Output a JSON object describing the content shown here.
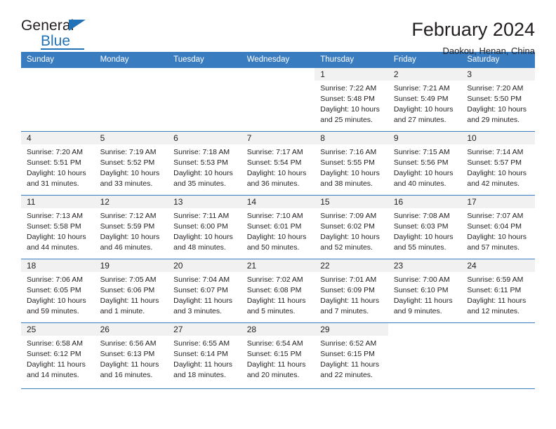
{
  "brand": {
    "name_part1": "General",
    "name_part2": "Blue"
  },
  "header": {
    "title": "February 2024",
    "subtitle": "Daokou, Henan, China"
  },
  "calendar": {
    "day_headers": [
      "Sunday",
      "Monday",
      "Tuesday",
      "Wednesday",
      "Thursday",
      "Friday",
      "Saturday"
    ],
    "colors": {
      "header_blue": "#3a7cc0",
      "daynum_band": "#f1f1f1",
      "text": "#231f20",
      "brand_blue": "#2272b8"
    },
    "weeks": [
      [
        {
          "day": "",
          "sunrise": "",
          "sunset": "",
          "daylight": ""
        },
        {
          "day": "",
          "sunrise": "",
          "sunset": "",
          "daylight": ""
        },
        {
          "day": "",
          "sunrise": "",
          "sunset": "",
          "daylight": ""
        },
        {
          "day": "",
          "sunrise": "",
          "sunset": "",
          "daylight": ""
        },
        {
          "day": "1",
          "sunrise": "Sunrise: 7:22 AM",
          "sunset": "Sunset: 5:48 PM",
          "daylight": "Daylight: 10 hours and 25 minutes."
        },
        {
          "day": "2",
          "sunrise": "Sunrise: 7:21 AM",
          "sunset": "Sunset: 5:49 PM",
          "daylight": "Daylight: 10 hours and 27 minutes."
        },
        {
          "day": "3",
          "sunrise": "Sunrise: 7:20 AM",
          "sunset": "Sunset: 5:50 PM",
          "daylight": "Daylight: 10 hours and 29 minutes."
        }
      ],
      [
        {
          "day": "4",
          "sunrise": "Sunrise: 7:20 AM",
          "sunset": "Sunset: 5:51 PM",
          "daylight": "Daylight: 10 hours and 31 minutes."
        },
        {
          "day": "5",
          "sunrise": "Sunrise: 7:19 AM",
          "sunset": "Sunset: 5:52 PM",
          "daylight": "Daylight: 10 hours and 33 minutes."
        },
        {
          "day": "6",
          "sunrise": "Sunrise: 7:18 AM",
          "sunset": "Sunset: 5:53 PM",
          "daylight": "Daylight: 10 hours and 35 minutes."
        },
        {
          "day": "7",
          "sunrise": "Sunrise: 7:17 AM",
          "sunset": "Sunset: 5:54 PM",
          "daylight": "Daylight: 10 hours and 36 minutes."
        },
        {
          "day": "8",
          "sunrise": "Sunrise: 7:16 AM",
          "sunset": "Sunset: 5:55 PM",
          "daylight": "Daylight: 10 hours and 38 minutes."
        },
        {
          "day": "9",
          "sunrise": "Sunrise: 7:15 AM",
          "sunset": "Sunset: 5:56 PM",
          "daylight": "Daylight: 10 hours and 40 minutes."
        },
        {
          "day": "10",
          "sunrise": "Sunrise: 7:14 AM",
          "sunset": "Sunset: 5:57 PM",
          "daylight": "Daylight: 10 hours and 42 minutes."
        }
      ],
      [
        {
          "day": "11",
          "sunrise": "Sunrise: 7:13 AM",
          "sunset": "Sunset: 5:58 PM",
          "daylight": "Daylight: 10 hours and 44 minutes."
        },
        {
          "day": "12",
          "sunrise": "Sunrise: 7:12 AM",
          "sunset": "Sunset: 5:59 PM",
          "daylight": "Daylight: 10 hours and 46 minutes."
        },
        {
          "day": "13",
          "sunrise": "Sunrise: 7:11 AM",
          "sunset": "Sunset: 6:00 PM",
          "daylight": "Daylight: 10 hours and 48 minutes."
        },
        {
          "day": "14",
          "sunrise": "Sunrise: 7:10 AM",
          "sunset": "Sunset: 6:01 PM",
          "daylight": "Daylight: 10 hours and 50 minutes."
        },
        {
          "day": "15",
          "sunrise": "Sunrise: 7:09 AM",
          "sunset": "Sunset: 6:02 PM",
          "daylight": "Daylight: 10 hours and 52 minutes."
        },
        {
          "day": "16",
          "sunrise": "Sunrise: 7:08 AM",
          "sunset": "Sunset: 6:03 PM",
          "daylight": "Daylight: 10 hours and 55 minutes."
        },
        {
          "day": "17",
          "sunrise": "Sunrise: 7:07 AM",
          "sunset": "Sunset: 6:04 PM",
          "daylight": "Daylight: 10 hours and 57 minutes."
        }
      ],
      [
        {
          "day": "18",
          "sunrise": "Sunrise: 7:06 AM",
          "sunset": "Sunset: 6:05 PM",
          "daylight": "Daylight: 10 hours and 59 minutes."
        },
        {
          "day": "19",
          "sunrise": "Sunrise: 7:05 AM",
          "sunset": "Sunset: 6:06 PM",
          "daylight": "Daylight: 11 hours and 1 minute."
        },
        {
          "day": "20",
          "sunrise": "Sunrise: 7:04 AM",
          "sunset": "Sunset: 6:07 PM",
          "daylight": "Daylight: 11 hours and 3 minutes."
        },
        {
          "day": "21",
          "sunrise": "Sunrise: 7:02 AM",
          "sunset": "Sunset: 6:08 PM",
          "daylight": "Daylight: 11 hours and 5 minutes."
        },
        {
          "day": "22",
          "sunrise": "Sunrise: 7:01 AM",
          "sunset": "Sunset: 6:09 PM",
          "daylight": "Daylight: 11 hours and 7 minutes."
        },
        {
          "day": "23",
          "sunrise": "Sunrise: 7:00 AM",
          "sunset": "Sunset: 6:10 PM",
          "daylight": "Daylight: 11 hours and 9 minutes."
        },
        {
          "day": "24",
          "sunrise": "Sunrise: 6:59 AM",
          "sunset": "Sunset: 6:11 PM",
          "daylight": "Daylight: 11 hours and 12 minutes."
        }
      ],
      [
        {
          "day": "25",
          "sunrise": "Sunrise: 6:58 AM",
          "sunset": "Sunset: 6:12 PM",
          "daylight": "Daylight: 11 hours and 14 minutes."
        },
        {
          "day": "26",
          "sunrise": "Sunrise: 6:56 AM",
          "sunset": "Sunset: 6:13 PM",
          "daylight": "Daylight: 11 hours and 16 minutes."
        },
        {
          "day": "27",
          "sunrise": "Sunrise: 6:55 AM",
          "sunset": "Sunset: 6:14 PM",
          "daylight": "Daylight: 11 hours and 18 minutes."
        },
        {
          "day": "28",
          "sunrise": "Sunrise: 6:54 AM",
          "sunset": "Sunset: 6:15 PM",
          "daylight": "Daylight: 11 hours and 20 minutes."
        },
        {
          "day": "29",
          "sunrise": "Sunrise: 6:52 AM",
          "sunset": "Sunset: 6:15 PM",
          "daylight": "Daylight: 11 hours and 22 minutes."
        },
        {
          "day": "",
          "sunrise": "",
          "sunset": "",
          "daylight": ""
        },
        {
          "day": "",
          "sunrise": "",
          "sunset": "",
          "daylight": ""
        }
      ]
    ]
  }
}
